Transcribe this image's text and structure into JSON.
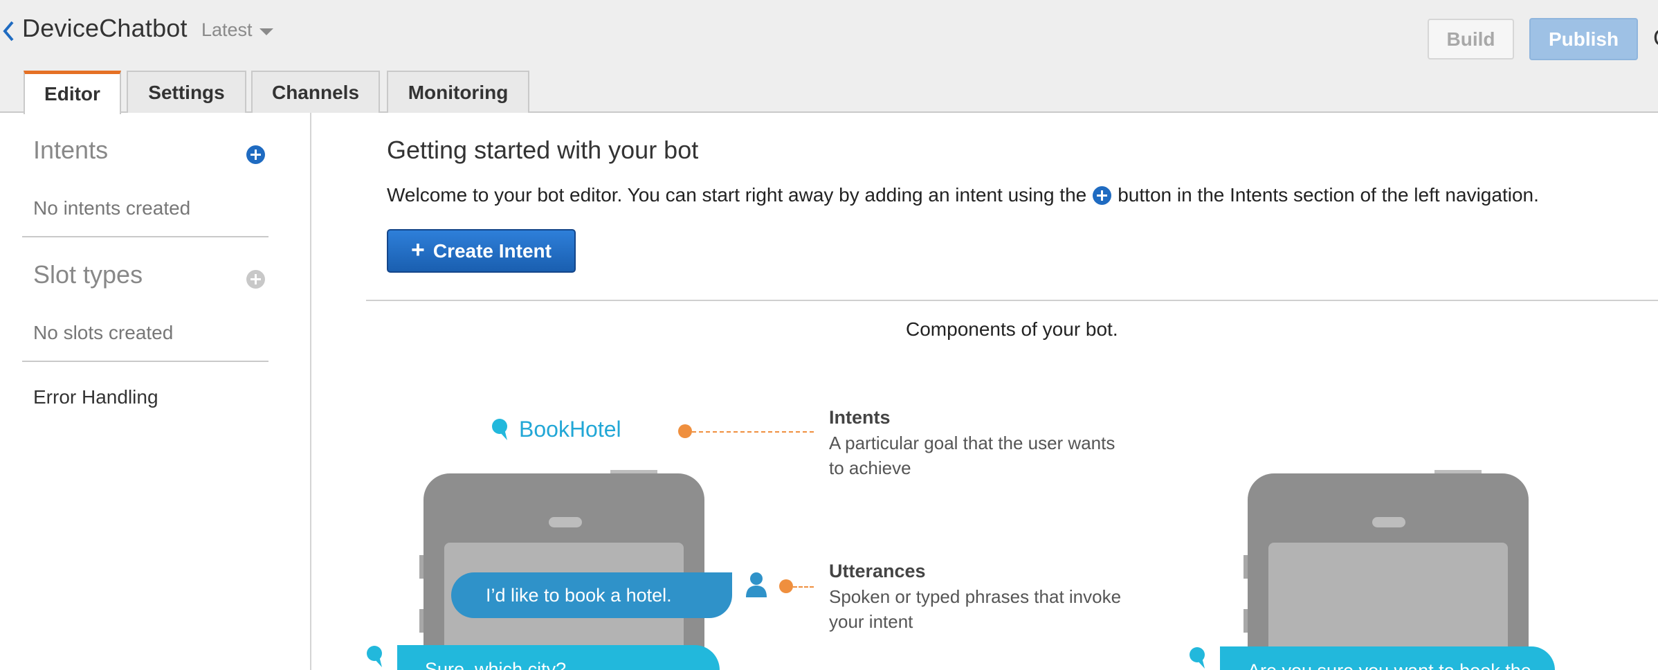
{
  "header": {
    "bot_name": "DeviceChatbot",
    "version": "Latest",
    "build_label": "Build",
    "publish_label": "Publish",
    "edge_glyph": "C"
  },
  "tabs": [
    {
      "label": "Editor",
      "active": true
    },
    {
      "label": "Settings",
      "active": false
    },
    {
      "label": "Channels",
      "active": false
    },
    {
      "label": "Monitoring",
      "active": false
    }
  ],
  "sidebar": {
    "intents_heading": "Intents",
    "intents_empty": "No intents created",
    "slots_heading": "Slot types",
    "slots_empty": "No slots created",
    "error_handling": "Error Handling"
  },
  "main": {
    "title": "Getting started with your bot",
    "welcome_before": "Welcome to your bot editor. You can start right away by adding an intent using the",
    "welcome_after": "button in the Intents section of the left navigation.",
    "create_intent_label": "Create Intent",
    "components_title": "Components of your bot."
  },
  "diagram": {
    "intent_name": "BookHotel",
    "intents_title": "Intents",
    "intents_desc": "A particular goal that the user wants to achieve",
    "utterances_title": "Utterances",
    "utterances_desc": "Spoken or typed phrases that invoke your intent",
    "user_utterance": "I’d like to book a hotel.",
    "bot_prompt_left": "Sure, which city?",
    "bot_prompt_right": "Are you sure you want to book the"
  },
  "colors": {
    "accent_orange": "#e57025",
    "primary_blue": "#1f6bc1",
    "diagram_cyan": "#22b8dc",
    "diagram_orange": "#ef8f3e"
  }
}
